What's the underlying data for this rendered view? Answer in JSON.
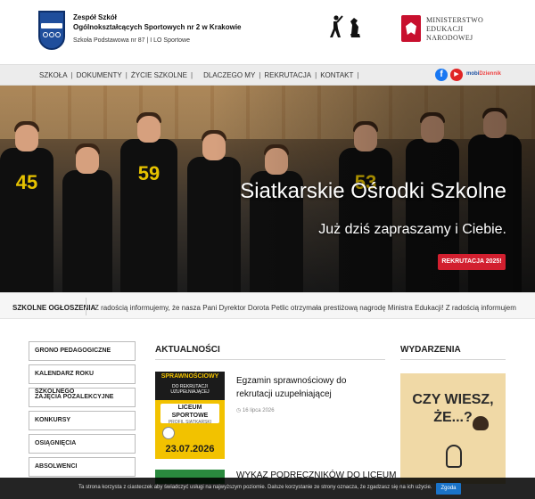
{
  "header": {
    "school_line1": "Zespół Szkół",
    "school_line2": "Ogólnokształcących Sportowych nr 2 w Krakowie",
    "school_line3": "Szkoła Podstawowa nr 87 | I LO Sportowe",
    "ministry": [
      "MINISTERSTWO",
      "EDUKACJI",
      "NARODOWEJ"
    ]
  },
  "nav": {
    "items": [
      "SZKOŁA",
      "DOKUMENTY",
      "ŻYCIE SZKOLNE",
      "DLACZEGO MY",
      "REKRUTACJA",
      "KONTAKT"
    ],
    "facebook": "f",
    "youtube": "▶",
    "mobi_a": "mobi",
    "mobi_b": "Dziennik"
  },
  "hero": {
    "title": "Siatkarskie Ośrodki Szkolne",
    "subtitle": "Już dziś zapraszamy i Ciebie.",
    "button": "REKRUTACJA 2025!",
    "jersey_numbers": [
      "45",
      "59",
      "53"
    ]
  },
  "announcements": {
    "label": "SZKOLNE OGŁOSZENIA",
    "text": "Z radością informujemy, że nasza Pani Dyrektor Dorota Petlic otrzymała prestiżową nagrodę Ministra Edukacji!      Z radością informujem"
  },
  "sidebar": {
    "items": [
      "GRONO PEDAGOGICZNE",
      "KALENDARZ ROKU SZKOLNEGO",
      "ZAJĘCIA POZALEKCYJNE",
      "KONKURSY",
      "OSIĄGNIĘCIA",
      "ABSOLWENCI"
    ]
  },
  "news": {
    "heading": "AKTUALNOŚCI",
    "article1": {
      "title": "Egzamin sprawnościowy do rekrutacji uzupełniającej",
      "date": "16 lipca 2026",
      "poster_top": "SPRAWNOŚCIOWY",
      "poster_sub": "DO REKRUTACJI UZUPEŁNIAJĄCEJ",
      "poster_band1": "LICEUM SPORTOWE",
      "poster_band2": "PROFIL SIATKARSKI",
      "poster_date": "23.07.2026"
    },
    "article2": {
      "title": "WYKAZ PODRĘCZNIKÓW DO LICEUM"
    }
  },
  "events": {
    "heading": "WYDARZENIA",
    "card_text": "CZY WIESZ, ŻE...?"
  },
  "cookie": {
    "text": "Ta strona korzysta z ciasteczek aby świadczyć usługi na najwyższym poziomie. Dalsze korzystanie ze strony oznacza, że zgadzasz się na ich użycie.",
    "button": "Zgoda"
  },
  "colors": {
    "accent_red": "#d21f2f",
    "nav_bg": "#ececec",
    "cookie_button": "#1a73c8",
    "poster_yellow": "#f2c200"
  }
}
